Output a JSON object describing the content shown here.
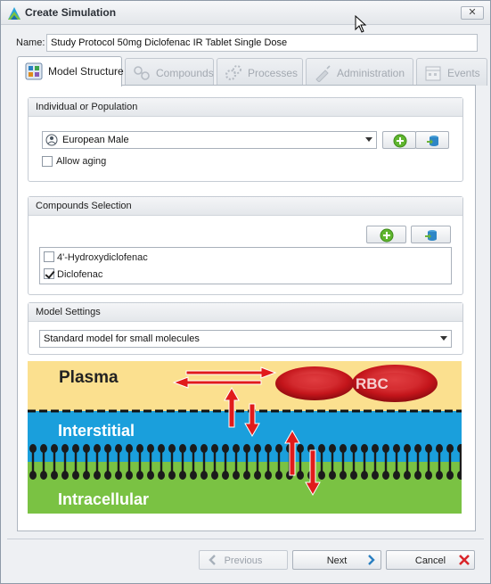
{
  "window": {
    "title": "Create Simulation",
    "close_label": "✕"
  },
  "name_field": {
    "label": "Name:",
    "value": "Study Protocol 50mg Diclofenac IR Tablet Single Dose"
  },
  "tabs": [
    {
      "label": "Model Structure",
      "icon": "model-structure-icon",
      "active": true
    },
    {
      "label": "Compounds",
      "icon": "compounds-icon",
      "active": false
    },
    {
      "label": "Processes",
      "icon": "processes-icon",
      "active": false
    },
    {
      "label": "Administration",
      "icon": "administration-icon",
      "active": false
    },
    {
      "label": "Events",
      "icon": "events-icon",
      "active": false
    }
  ],
  "individual_group": {
    "header": "Individual or Population",
    "selected": "European Male",
    "allow_aging_label": "Allow aging",
    "allow_aging_checked": false
  },
  "compounds_group": {
    "header": "Compounds Selection",
    "items": [
      {
        "label": "4'-Hydroxydiclofenac",
        "checked": false
      },
      {
        "label": "Diclofenac",
        "checked": true
      }
    ]
  },
  "model_settings_group": {
    "header": "Model Settings",
    "selected": "Standard model for small molecules"
  },
  "diagram": {
    "plasma_label": "Plasma",
    "rbc_label": "RBC",
    "interstitial_label": "Interstitial",
    "intracellular_label": "Intracellular"
  },
  "footer": {
    "previous_label": "Previous",
    "next_label": "Next",
    "cancel_label": "Cancel"
  },
  "colors": {
    "plasma": "#fbe08f",
    "interstitial": "#1a9fdc",
    "intracellular": "#7ac243",
    "arrow": "#e11b1b",
    "add_green": "#5fb52e"
  }
}
